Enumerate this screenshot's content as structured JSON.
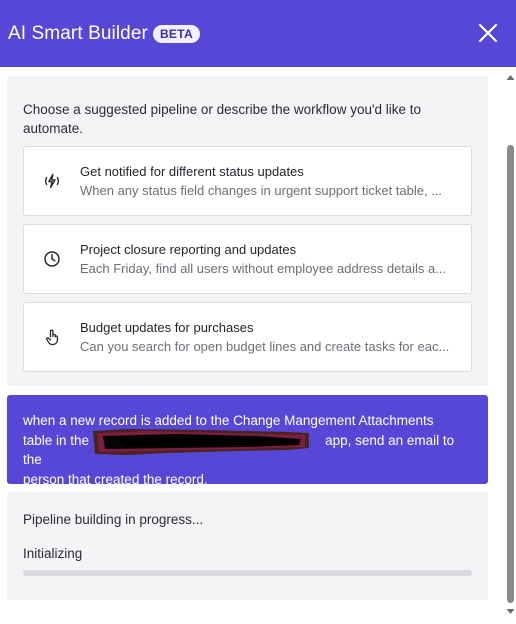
{
  "header": {
    "title": "AI Smart Builder",
    "badge": "BETA",
    "accent_color": "#5747d6",
    "close_icon": "close-icon"
  },
  "suggestions": {
    "intro": "Choose a suggested pipeline or describe the workflow you'd like to automate.",
    "cards": [
      {
        "icon": "lightning-icon",
        "title": "Get notified for different status updates",
        "description": "When any status field changes in urgent support ticket table, ..."
      },
      {
        "icon": "clock-icon",
        "title": "Project closure reporting and updates",
        "description": "Each Friday, find all users without employee address details a..."
      },
      {
        "icon": "hand-pointer-icon",
        "title": "Budget updates for purchases",
        "description": "Can you search for open budget lines and create tasks for eac..."
      }
    ]
  },
  "user_message": {
    "line1": "when a new record is added to the Change Mangement Attachments",
    "line2_start": "table in the",
    "line2_end": "app, send an email to the",
    "line3": "person that created the record."
  },
  "progress": {
    "title": "Pipeline building in progress...",
    "status": "Initializing",
    "fraction": 0.0
  }
}
